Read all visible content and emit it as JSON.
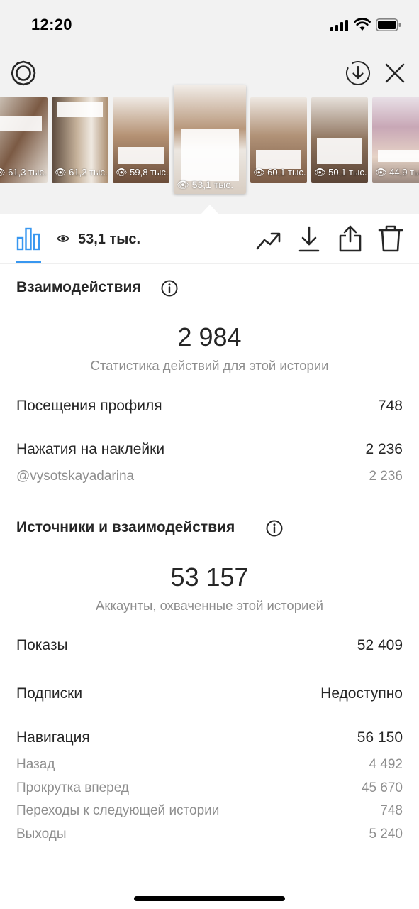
{
  "status_bar": {
    "time": "12:20"
  },
  "stories": [
    {
      "views": "61,3 тыс.",
      "tint": "#7b5a44"
    },
    {
      "views": "61,2 тыс.",
      "tint": "#a98a6c"
    },
    {
      "views": "59,8 тыс.",
      "tint": "#b59274"
    },
    {
      "views": "53,1 тыс.",
      "tint": "#b8987c"
    },
    {
      "views": "60,1 тыс.",
      "tint": "#b19277"
    },
    {
      "views": "50,1 тыс.",
      "tint": "#8e735d"
    },
    {
      "views": "44,9 тыс.",
      "tint": "#c8a7b6"
    }
  ],
  "tab_bar": {
    "view_count": "53,1 тыс."
  },
  "interactions": {
    "title": "Взаимодействия",
    "total": "2 984",
    "caption": "Статистика действий для этой истории",
    "rows": [
      {
        "label": "Посещения профиля",
        "value": "748"
      },
      {
        "label": "Нажатия на наклейки",
        "value": "2 236"
      }
    ],
    "sub_rows": [
      {
        "label": "@vysotskayadarina",
        "value": "2 236"
      }
    ]
  },
  "discovery": {
    "title": "Источники и взаимодействия",
    "total": "53 157",
    "caption": "Аккаунты, охваченные этой историей",
    "rows": [
      {
        "label": "Показы",
        "value": "52 409"
      },
      {
        "label": "Подписки",
        "value": "Недоступно"
      },
      {
        "label": "Навигация",
        "value": "56 150"
      }
    ],
    "navigation_details": [
      {
        "label": "Назад",
        "value": "4 492"
      },
      {
        "label": "Прокрутка вперед",
        "value": "45 670"
      },
      {
        "label": "Переходы к следующей истории",
        "value": "748"
      },
      {
        "label": "Выходы",
        "value": "5 240"
      }
    ]
  },
  "colors": {
    "accent": "#3897f0",
    "text": "#262626",
    "secondary": "#8e8e8e",
    "top_background": "#f2f2f2"
  }
}
